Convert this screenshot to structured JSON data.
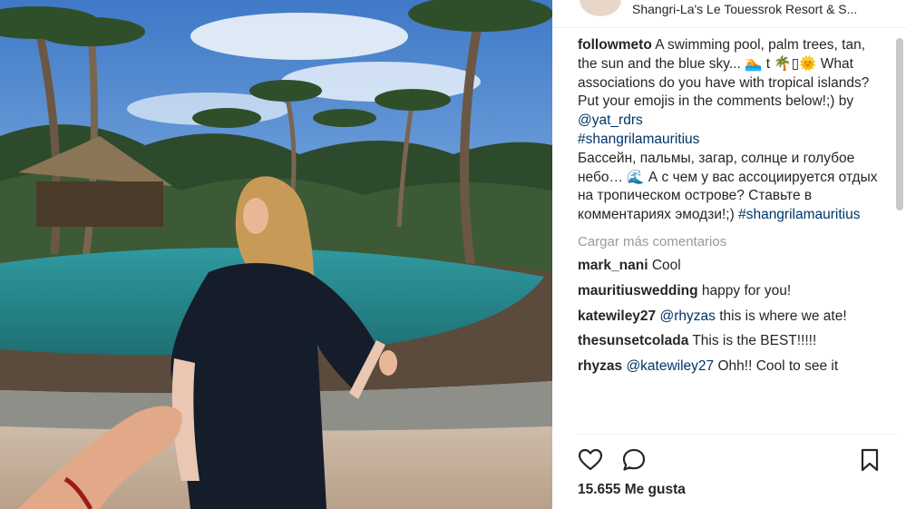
{
  "header": {
    "location": "Shangri-La's Le Touessrok Resort & S..."
  },
  "caption": {
    "username": "followmeto",
    "text_en": " A swimming pool, palm trees, tan, the sun and the blue sky... 🏊 t 🌴▯🌞 What associations do you have with tropical islands? Put your emojis in the comments below!;)  by ",
    "mention": "@yat_rdrs",
    "hashtag_1": "#shangrilamauritius",
    "text_ru": "Бассейн, пальмы, загар, солнце и голубое небо… 🌊 А с чем у вас ассоциируется отдых на тропическом острове? Ставьте в комментариях эмодзи!;) ",
    "hashtag_2": "#shangrilamauritius"
  },
  "load_more": "Cargar más comentarios",
  "comments": [
    {
      "user": "mark_nani",
      "pre": " Cool",
      "mention": "",
      "post": ""
    },
    {
      "user": "mauritiuswedding",
      "pre": " happy for you!",
      "mention": "",
      "post": ""
    },
    {
      "user": "katewiley27",
      "pre": " ",
      "mention": "@rhyzas",
      "post": " this is where we ate!"
    },
    {
      "user": "thesunsetcolada",
      "pre": " This is the BEST!!!!!",
      "mention": "",
      "post": ""
    },
    {
      "user": "rhyzas",
      "pre": " ",
      "mention": "@katewiley27",
      "post": " Ohh!! Cool to see it"
    }
  ],
  "actions": {
    "like_icon": "heart-outline-icon",
    "comment_icon": "comment-bubble-icon",
    "save_icon": "bookmark-icon"
  },
  "likes": "15.655 Me gusta",
  "colors": {
    "text": "#262626",
    "link": "#003569",
    "muted": "#999999",
    "sky": "#5b8fd0",
    "pool": "#2f8f93"
  }
}
